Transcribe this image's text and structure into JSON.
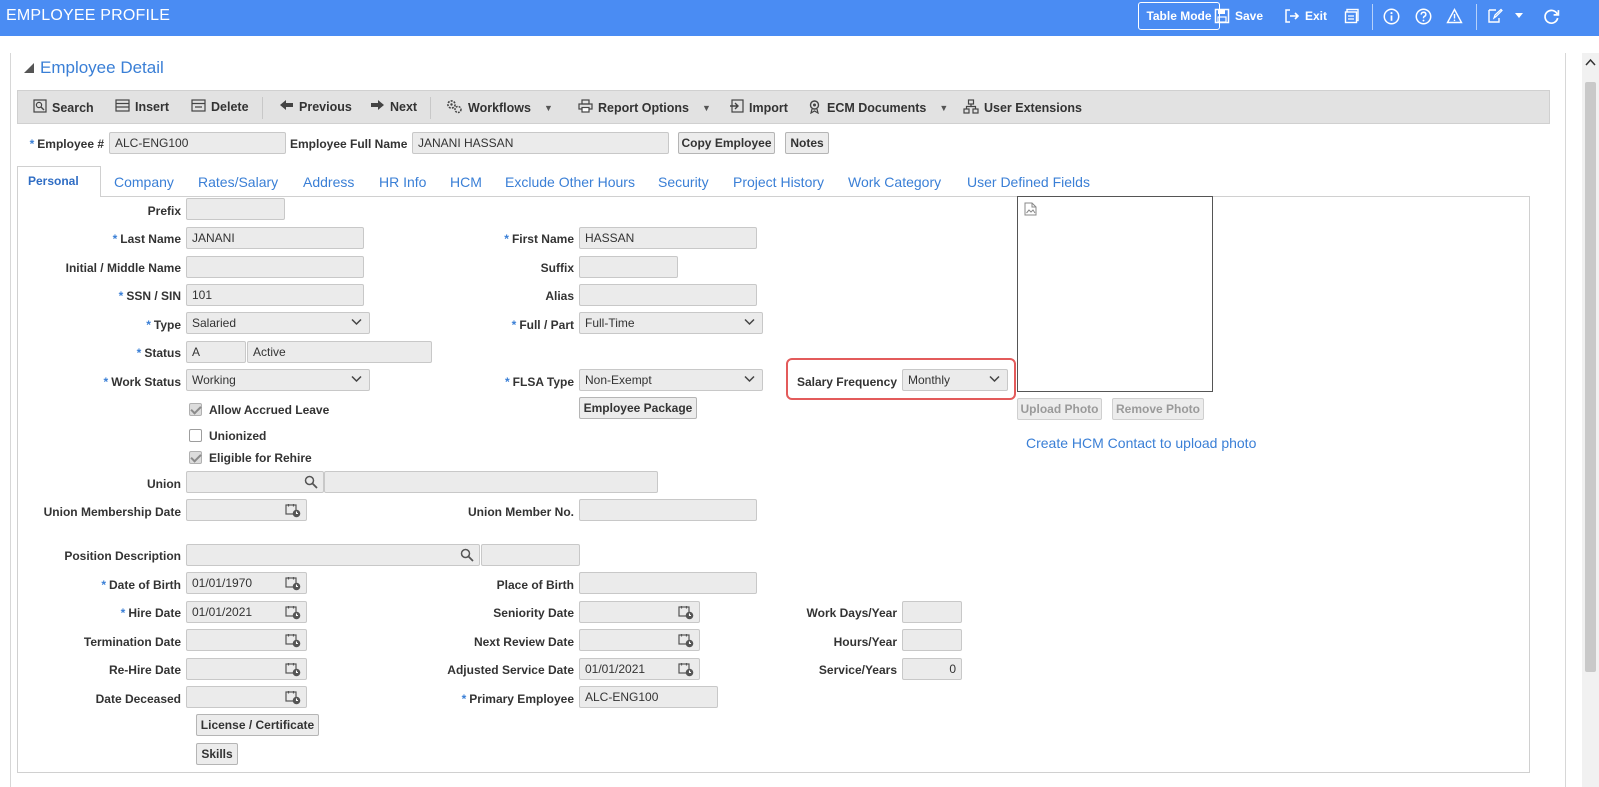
{
  "window": {
    "title": "EMPLOYEE PROFILE",
    "table_mode": "Table Mode",
    "save": "Save",
    "exit": "Exit"
  },
  "section": {
    "title": "Employee Detail"
  },
  "toolbar": {
    "search": "Search",
    "insert": "Insert",
    "delete": "Delete",
    "previous": "Previous",
    "next": "Next",
    "workflows": "Workflows",
    "report_options": "Report Options",
    "import": "Import",
    "ecm_documents": "ECM Documents",
    "user_extensions": "User Extensions"
  },
  "header": {
    "employee_no_label": "Employee #",
    "employee_no": "ALC-ENG100",
    "full_name_label": "Employee Full Name",
    "full_name": "JANANI HASSAN",
    "copy_employee": "Copy Employee",
    "notes": "Notes"
  },
  "tabs": [
    "Personal",
    "Company",
    "Rates/Salary",
    "Address",
    "HR Info",
    "HCM",
    "Exclude Other Hours",
    "Security",
    "Project History",
    "Work Category",
    "User Defined Fields"
  ],
  "form": {
    "prefix": {
      "label": "Prefix",
      "value": ""
    },
    "last_name": {
      "label": "Last Name",
      "value": "JANANI"
    },
    "first_name": {
      "label": "First Name",
      "value": "HASSAN"
    },
    "middle_name": {
      "label": "Initial / Middle Name",
      "value": ""
    },
    "suffix": {
      "label": "Suffix",
      "value": ""
    },
    "ssn": {
      "label": "SSN / SIN",
      "value": "101"
    },
    "alias": {
      "label": "Alias",
      "value": ""
    },
    "type": {
      "label": "Type",
      "value": "Salaried"
    },
    "full_part": {
      "label": "Full / Part",
      "value": "Full-Time"
    },
    "status": {
      "label": "Status",
      "code": "A",
      "value": "Active"
    },
    "work_status": {
      "label": "Work Status",
      "value": "Working"
    },
    "flsa_type": {
      "label": "FLSA Type",
      "value": "Non-Exempt"
    },
    "salary_frequency": {
      "label": "Salary Frequency",
      "value": "Monthly"
    },
    "employee_package": "Employee Package",
    "allow_accrued_leave": {
      "label": "Allow Accrued Leave",
      "checked": true
    },
    "unionized": {
      "label": "Unionized",
      "checked": false
    },
    "eligible_rehire": {
      "label": "Eligible for Rehire",
      "checked": true
    },
    "union": {
      "label": "Union",
      "value": "",
      "desc": ""
    },
    "union_membership_date": {
      "label": "Union Membership Date",
      "value": ""
    },
    "union_member_no": {
      "label": "Union Member No.",
      "value": ""
    },
    "position_description": {
      "label": "Position Description",
      "value": "",
      "code": ""
    },
    "date_of_birth": {
      "label": "Date of Birth",
      "value": "01/01/1970"
    },
    "place_of_birth": {
      "label": "Place of Birth",
      "value": ""
    },
    "hire_date": {
      "label": "Hire Date",
      "value": "01/01/2021"
    },
    "seniority_date": {
      "label": "Seniority Date",
      "value": ""
    },
    "work_days_year": {
      "label": "Work Days/Year",
      "value": ""
    },
    "termination_date": {
      "label": "Termination Date",
      "value": ""
    },
    "next_review_date": {
      "label": "Next Review Date",
      "value": ""
    },
    "hours_year": {
      "label": "Hours/Year",
      "value": ""
    },
    "rehire_date": {
      "label": "Re-Hire Date",
      "value": ""
    },
    "adjusted_service_date": {
      "label": "Adjusted Service Date",
      "value": "01/01/2021"
    },
    "service_years": {
      "label": "Service/Years",
      "value": "0"
    },
    "date_deceased": {
      "label": "Date Deceased",
      "value": ""
    },
    "primary_employee": {
      "label": "Primary Employee",
      "value": "ALC-ENG100"
    },
    "license_certificate": "License / Certificate",
    "skills": "Skills"
  },
  "photo": {
    "upload": "Upload Photo",
    "remove": "Remove Photo",
    "hcm_link": "Create HCM Contact to upload photo"
  }
}
